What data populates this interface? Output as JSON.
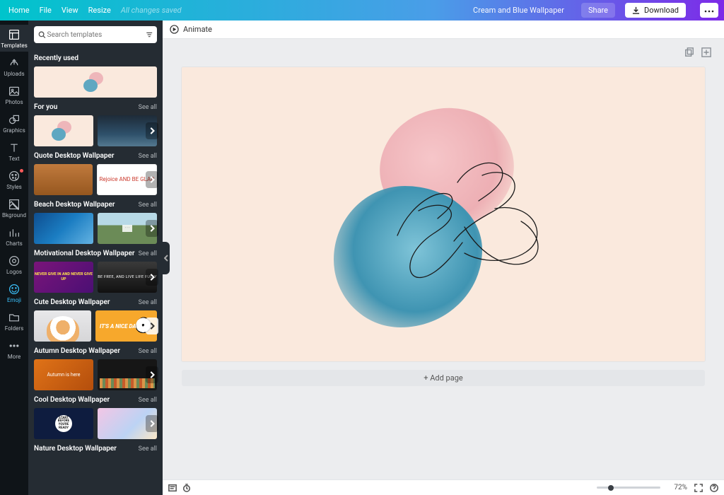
{
  "topbar": {
    "home": "Home",
    "menu": [
      "File",
      "View",
      "Resize"
    ],
    "saved": "All changes saved",
    "docname": "Cream and Blue Wallpaper",
    "share": "Share",
    "download": "Download"
  },
  "rail": [
    {
      "id": "templates",
      "label": "Templates",
      "active": true
    },
    {
      "id": "uploads",
      "label": "Uploads"
    },
    {
      "id": "photos",
      "label": "Photos"
    },
    {
      "id": "graphics",
      "label": "Graphics"
    },
    {
      "id": "text",
      "label": "Text"
    },
    {
      "id": "styles",
      "label": "Styles",
      "badge": true
    },
    {
      "id": "bkground",
      "label": "Bkground"
    },
    {
      "id": "charts",
      "label": "Charts"
    },
    {
      "id": "logos",
      "label": "Logos"
    },
    {
      "id": "emoji",
      "label": "Emoji",
      "active_color": true
    },
    {
      "id": "folders",
      "label": "Folders"
    },
    {
      "id": "more",
      "label": "More"
    }
  ],
  "search": {
    "placeholder": "Search templates"
  },
  "see_all": "See all",
  "sections": {
    "recent": "Recently used",
    "foryou": "For you",
    "quote": "Quote Desktop Wallpaper",
    "beach": "Beach Desktop Wallpaper",
    "motiv": "Motivational Desktop Wallpaper",
    "cute": "Cute Desktop Wallpaper",
    "autumn": "Autumn Desktop Wallpaper",
    "cool": "Cool Desktop Wallpaper",
    "nature": "Nature Desktop Wallpaper"
  },
  "thumb_text": {
    "rejoice": "Rejoice AND BE GLAD",
    "purple": "NEVER GIVE IN AND NEVER GIVE UP",
    "bw": "BE FREE, AND LIVE LIFE FULLY",
    "niceday": "IT'S A NICE DAY!",
    "autumn": "Autumn is here",
    "cool": "START BEFORE YOU'RE READY"
  },
  "canvas": {
    "animate": "Animate",
    "add_page": "+ Add page"
  },
  "footer": {
    "zoom": "72%"
  }
}
